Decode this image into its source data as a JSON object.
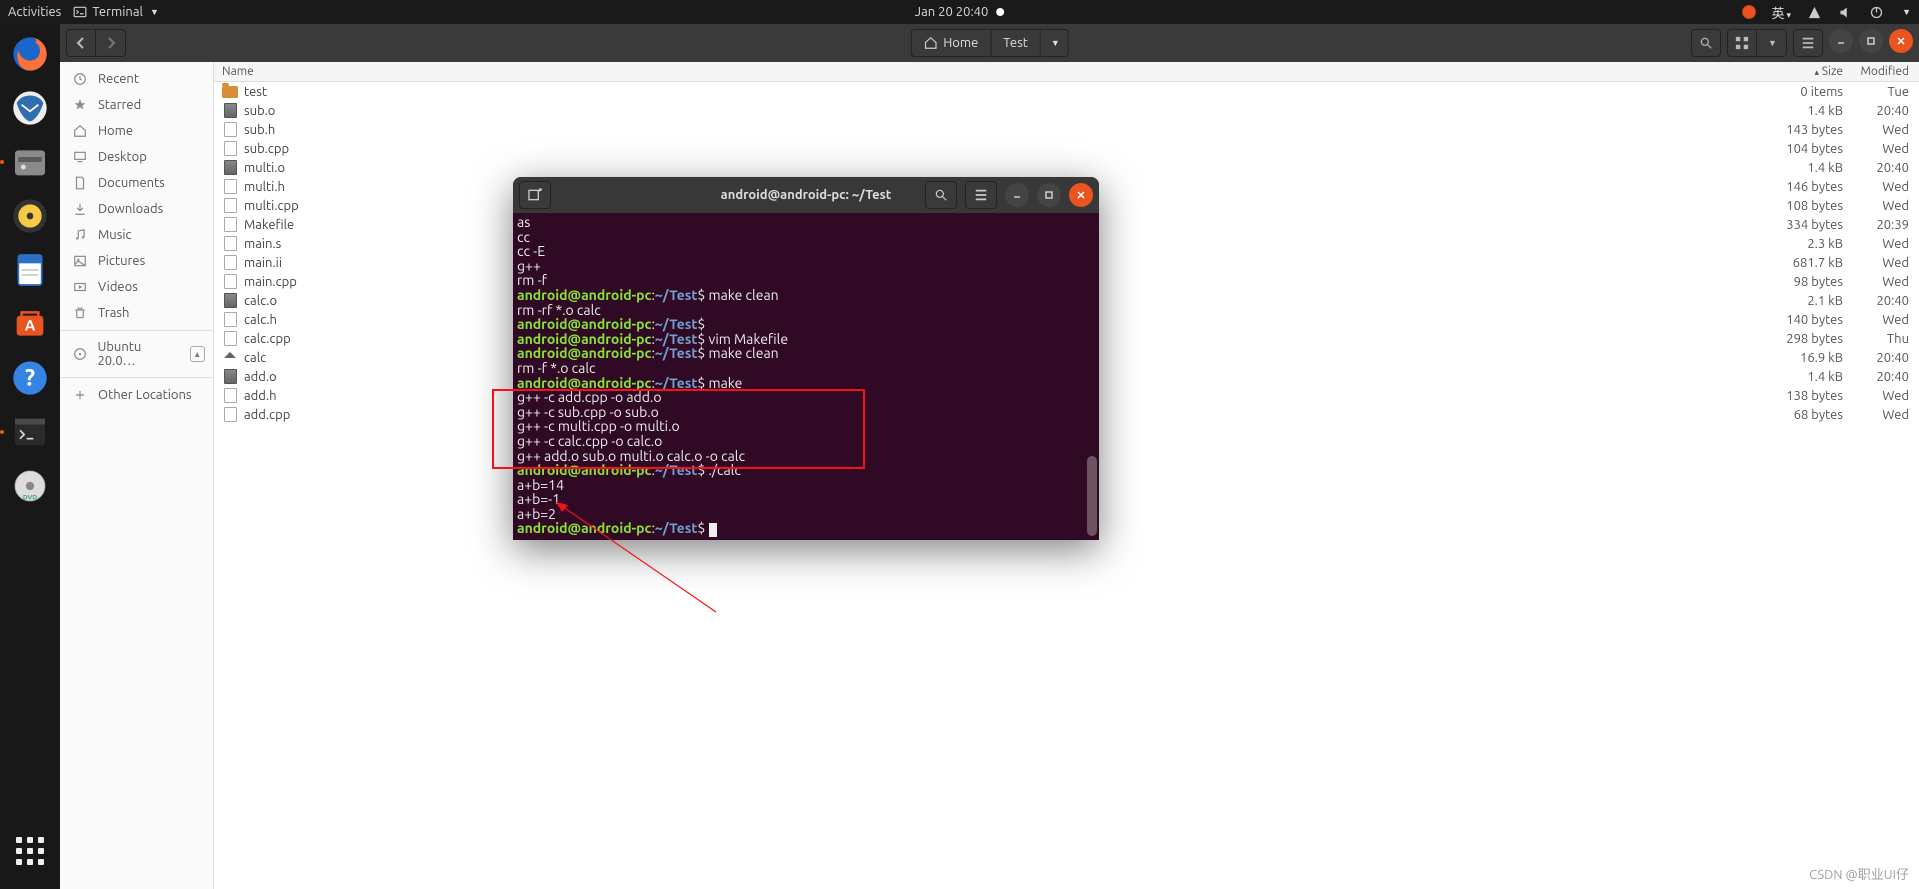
{
  "topbar": {
    "activities": "Activities",
    "app_label": "Terminal",
    "datetime": "Jan 20  20:40",
    "input_method": "英"
  },
  "dock": {
    "items": [
      "firefox",
      "thunderbird",
      "files",
      "rhythmbox",
      "writer",
      "software",
      "help",
      "terminal",
      "disc"
    ]
  },
  "fm": {
    "path": {
      "home": "Home",
      "current": "Test"
    },
    "columns": {
      "name": "Name",
      "size": "Size",
      "modified": "Modified"
    },
    "sidebar": [
      {
        "id": "recent",
        "label": "Recent",
        "icon": "clock"
      },
      {
        "id": "starred",
        "label": "Starred",
        "icon": "star"
      },
      {
        "id": "home",
        "label": "Home",
        "icon": "home"
      },
      {
        "id": "desktop",
        "label": "Desktop",
        "icon": "desktop"
      },
      {
        "id": "documents",
        "label": "Documents",
        "icon": "doc"
      },
      {
        "id": "downloads",
        "label": "Downloads",
        "icon": "download"
      },
      {
        "id": "music",
        "label": "Music",
        "icon": "music"
      },
      {
        "id": "pictures",
        "label": "Pictures",
        "icon": "pic"
      },
      {
        "id": "videos",
        "label": "Videos",
        "icon": "video"
      },
      {
        "id": "trash",
        "label": "Trash",
        "icon": "trash"
      },
      {
        "id": "ubuntu",
        "label": "Ubuntu 20.0…",
        "icon": "disk",
        "eject": true
      },
      {
        "id": "other",
        "label": "Other Locations",
        "icon": "plus"
      }
    ],
    "files": [
      {
        "name": "test",
        "type": "folder",
        "size": "0 items",
        "mod": "Tue"
      },
      {
        "name": "sub.o",
        "type": "bin",
        "size": "1.4 kB",
        "mod": "20:40"
      },
      {
        "name": "sub.h",
        "type": "doc",
        "size": "143 bytes",
        "mod": "Wed"
      },
      {
        "name": "sub.cpp",
        "type": "doc",
        "size": "104 bytes",
        "mod": "Wed"
      },
      {
        "name": "multi.o",
        "type": "bin",
        "size": "1.4 kB",
        "mod": "20:40"
      },
      {
        "name": "multi.h",
        "type": "doc",
        "size": "146 bytes",
        "mod": "Wed"
      },
      {
        "name": "multi.cpp",
        "type": "doc",
        "size": "108 bytes",
        "mod": "Wed"
      },
      {
        "name": "Makefile",
        "type": "doc",
        "size": "334 bytes",
        "mod": "20:39"
      },
      {
        "name": "main.s",
        "type": "doc",
        "size": "2.3 kB",
        "mod": "Wed"
      },
      {
        "name": "main.ii",
        "type": "doc",
        "size": "681.7 kB",
        "mod": "Wed"
      },
      {
        "name": "main.cpp",
        "type": "doc",
        "size": "98 bytes",
        "mod": "Wed"
      },
      {
        "name": "calc.o",
        "type": "bin",
        "size": "2.1 kB",
        "mod": "20:40"
      },
      {
        "name": "calc.h",
        "type": "doc",
        "size": "140 bytes",
        "mod": "Wed"
      },
      {
        "name": "calc.cpp",
        "type": "doc",
        "size": "298 bytes",
        "mod": "Thu"
      },
      {
        "name": "calc",
        "type": "exec",
        "size": "16.9 kB",
        "mod": "20:40"
      },
      {
        "name": "add.o",
        "type": "bin",
        "size": "1.4 kB",
        "mod": "20:40"
      },
      {
        "name": "add.h",
        "type": "doc",
        "size": "138 bytes",
        "mod": "Wed"
      },
      {
        "name": "add.cpp",
        "type": "doc",
        "size": "68 bytes",
        "mod": "Wed"
      }
    ]
  },
  "terminal": {
    "title": "android@android-pc: ~/Test",
    "prompt_user": "android@android-pc",
    "prompt_path": "~/Test",
    "lines": [
      {
        "t": "out",
        "text": "as"
      },
      {
        "t": "out",
        "text": "cc"
      },
      {
        "t": "out",
        "text": "cc -E"
      },
      {
        "t": "out",
        "text": "g++"
      },
      {
        "t": "out",
        "text": "rm -f"
      },
      {
        "t": "cmd",
        "text": "make clean"
      },
      {
        "t": "out",
        "text": "rm -rf *.o calc"
      },
      {
        "t": "cmd",
        "text": ""
      },
      {
        "t": "cmd",
        "text": "vim Makefile"
      },
      {
        "t": "cmd",
        "text": "make clean"
      },
      {
        "t": "out",
        "text": "rm -f *.o calc"
      },
      {
        "t": "cmd",
        "text": "make"
      },
      {
        "t": "out",
        "text": "g++ -c add.cpp -o add.o"
      },
      {
        "t": "out",
        "text": "g++ -c sub.cpp -o sub.o"
      },
      {
        "t": "out",
        "text": "g++ -c multi.cpp -o multi.o"
      },
      {
        "t": "out",
        "text": "g++ -c calc.cpp -o calc.o"
      },
      {
        "t": "out",
        "text": "g++ add.o sub.o multi.o calc.o -o calc"
      },
      {
        "t": "cmd",
        "text": "./calc"
      },
      {
        "t": "out",
        "text": "a+b=14"
      },
      {
        "t": "out",
        "text": "a+b=-1"
      },
      {
        "t": "out",
        "text": "a+b=2"
      },
      {
        "t": "prompt"
      }
    ]
  },
  "watermark": "CSDN @职业UI仔"
}
